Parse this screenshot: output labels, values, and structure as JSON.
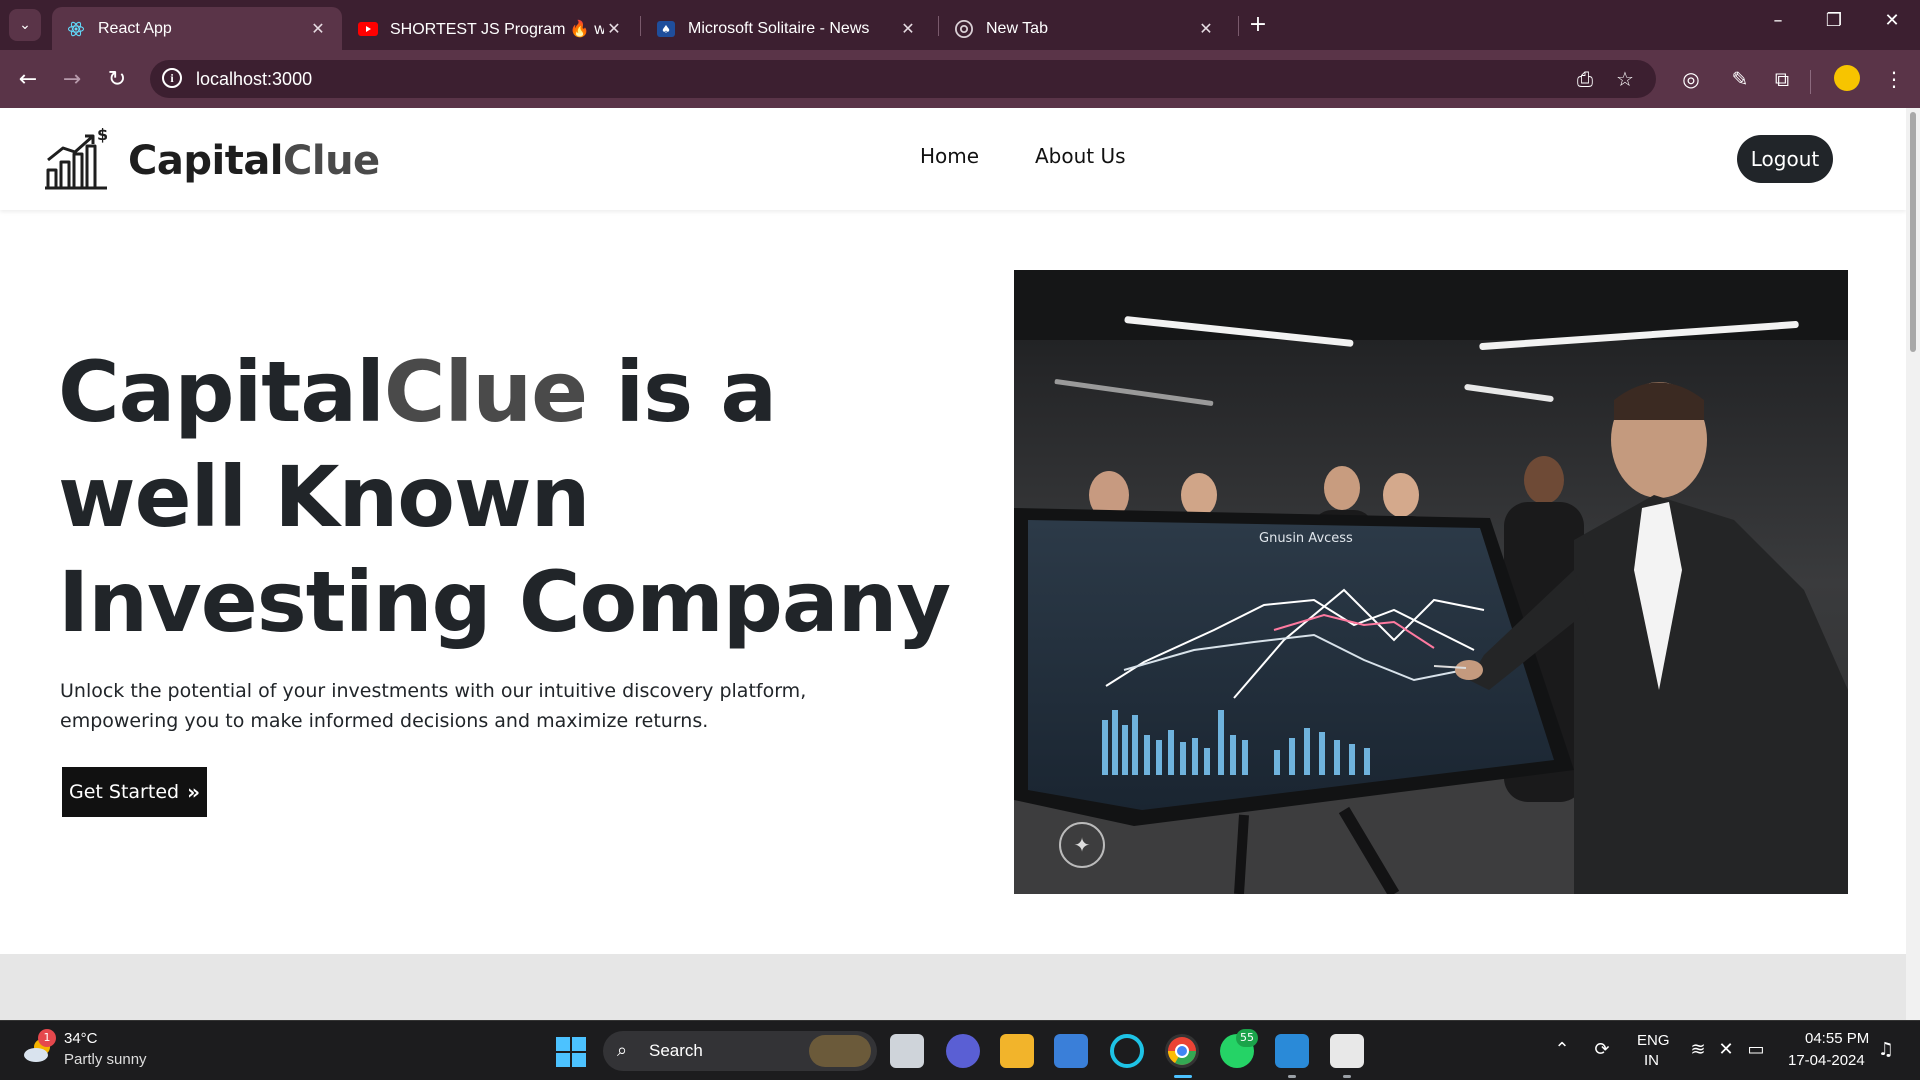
{
  "browser": {
    "tabs": [
      {
        "label": "React App",
        "active": true,
        "icon": "react-icon"
      },
      {
        "label": "SHORTEST JS Program 🔥 winc",
        "active": false,
        "icon": "youtube-icon"
      },
      {
        "label": "Microsoft Solitaire - News",
        "active": false,
        "icon": "solitaire-icon"
      },
      {
        "label": "New Tab",
        "active": false,
        "icon": "chrome-icon"
      }
    ],
    "url": "localhost:3000"
  },
  "site": {
    "brand_primary": "Capital",
    "brand_secondary": "Clue",
    "nav": [
      "Home",
      "About Us"
    ],
    "logout_label": "Logout",
    "hero": {
      "title_part1": "Capital",
      "title_accent": "Clue",
      "title_part2": " is a well Known Investing Company",
      "description": "Unlock the potential of your investments with our intuitive discovery platform, empowering you to make informed decisions and maximize returns.",
      "cta_label": "Get Started"
    },
    "image_screen_title": "Gnusin Avcess"
  },
  "colors": {
    "tab_bar": "#3c1f30",
    "toolbar": "#5a3448",
    "brand_dark": "#1e1e1e",
    "brand_accent": "#4a4a4a",
    "button_dark": "#212529"
  },
  "taskbar": {
    "weather_badge": "1",
    "temperature": "34°C",
    "condition": "Partly sunny",
    "search_label": "Search",
    "whatsapp_badge": "55",
    "lang_line1": "ENG",
    "lang_line2": "IN",
    "time": "04:55 PM",
    "date": "17-04-2024"
  }
}
